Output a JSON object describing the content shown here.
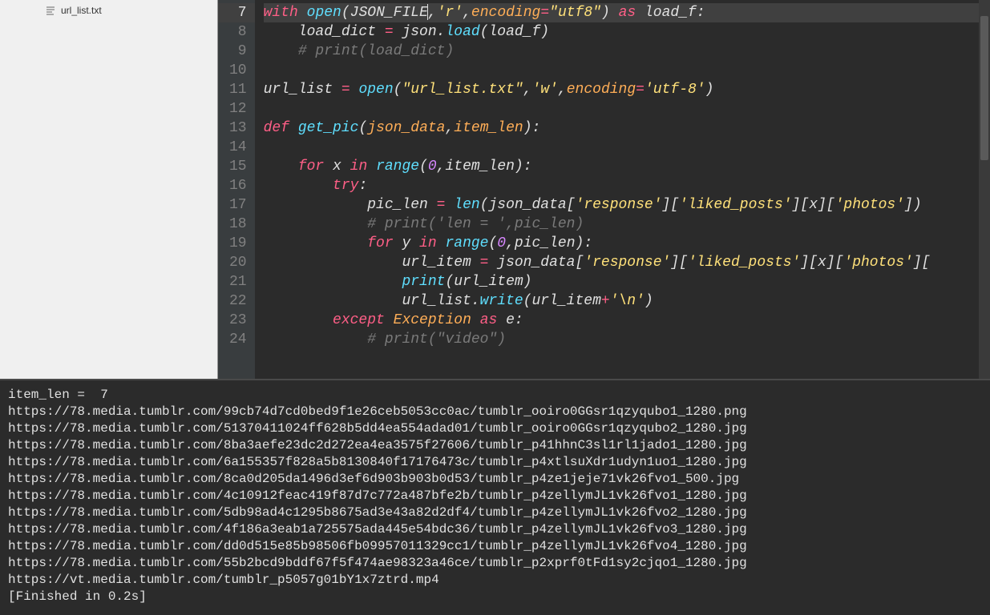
{
  "sidebar": {
    "files": [
      {
        "name": "url_list.txt",
        "icon": "text-lines-icon"
      }
    ]
  },
  "editor": {
    "active_line": 7,
    "lines": [
      {
        "n": 7,
        "tokens": [
          [
            "kw",
            "with"
          ],
          [
            "nm",
            " "
          ],
          [
            "fn",
            "open"
          ],
          [
            "nm",
            "(JSON_FILE"
          ],
          [
            "nm",
            ","
          ],
          [
            "str",
            "'r'"
          ],
          [
            "nm",
            ","
          ],
          [
            "param",
            "encoding"
          ],
          [
            "op",
            "="
          ],
          [
            "str",
            "\"utf8\""
          ],
          [
            "nm",
            ") "
          ],
          [
            "kw",
            "as"
          ],
          [
            "nm",
            " load_f:"
          ]
        ]
      },
      {
        "n": 8,
        "tokens": [
          [
            "nm",
            "    load_dict "
          ],
          [
            "op",
            "="
          ],
          [
            "nm",
            " json."
          ],
          [
            "fn",
            "load"
          ],
          [
            "nm",
            "(load_f)"
          ]
        ]
      },
      {
        "n": 9,
        "tokens": [
          [
            "nm",
            "    "
          ],
          [
            "cm",
            "# print(load_dict)"
          ]
        ]
      },
      {
        "n": 10,
        "tokens": []
      },
      {
        "n": 11,
        "tokens": [
          [
            "nm",
            "url_list "
          ],
          [
            "op",
            "="
          ],
          [
            "nm",
            " "
          ],
          [
            "fn",
            "open"
          ],
          [
            "nm",
            "("
          ],
          [
            "str",
            "\"url_list.txt\""
          ],
          [
            "nm",
            ","
          ],
          [
            "str",
            "'w'"
          ],
          [
            "nm",
            ","
          ],
          [
            "param",
            "encoding"
          ],
          [
            "op",
            "="
          ],
          [
            "str",
            "'utf-8'"
          ],
          [
            "nm",
            ")"
          ]
        ]
      },
      {
        "n": 12,
        "tokens": []
      },
      {
        "n": 13,
        "tokens": [
          [
            "kw",
            "def"
          ],
          [
            "nm",
            " "
          ],
          [
            "fn",
            "get_pic"
          ],
          [
            "nm",
            "("
          ],
          [
            "param",
            "json_data"
          ],
          [
            "nm",
            ","
          ],
          [
            "param",
            "item_len"
          ],
          [
            "nm",
            "):"
          ]
        ]
      },
      {
        "n": 14,
        "tokens": []
      },
      {
        "n": 15,
        "tokens": [
          [
            "nm",
            "    "
          ],
          [
            "kw",
            "for"
          ],
          [
            "nm",
            " x "
          ],
          [
            "kw",
            "in"
          ],
          [
            "nm",
            " "
          ],
          [
            "fn",
            "range"
          ],
          [
            "nm",
            "("
          ],
          [
            "num",
            "0"
          ],
          [
            "nm",
            ",item_len):"
          ]
        ]
      },
      {
        "n": 16,
        "tokens": [
          [
            "nm",
            "        "
          ],
          [
            "kw",
            "try"
          ],
          [
            "nm",
            ":"
          ]
        ]
      },
      {
        "n": 17,
        "tokens": [
          [
            "nm",
            "            pic_len "
          ],
          [
            "op",
            "="
          ],
          [
            "nm",
            " "
          ],
          [
            "fn",
            "len"
          ],
          [
            "nm",
            "(json_data["
          ],
          [
            "str",
            "'response'"
          ],
          [
            "nm",
            "]["
          ],
          [
            "str",
            "'liked_posts'"
          ],
          [
            "nm",
            "][x]["
          ],
          [
            "str",
            "'photos'"
          ],
          [
            "nm",
            "])"
          ]
        ]
      },
      {
        "n": 18,
        "tokens": [
          [
            "nm",
            "            "
          ],
          [
            "cm",
            "# print('len = ',pic_len)"
          ]
        ]
      },
      {
        "n": 19,
        "tokens": [
          [
            "nm",
            "            "
          ],
          [
            "kw",
            "for"
          ],
          [
            "nm",
            " y "
          ],
          [
            "kw",
            "in"
          ],
          [
            "nm",
            " "
          ],
          [
            "fn",
            "range"
          ],
          [
            "nm",
            "("
          ],
          [
            "num",
            "0"
          ],
          [
            "nm",
            ",pic_len):"
          ]
        ]
      },
      {
        "n": 20,
        "tokens": [
          [
            "nm",
            "                url_item "
          ],
          [
            "op",
            "="
          ],
          [
            "nm",
            " json_data["
          ],
          [
            "str",
            "'response'"
          ],
          [
            "nm",
            "]["
          ],
          [
            "str",
            "'liked_posts'"
          ],
          [
            "nm",
            "][x]["
          ],
          [
            "str",
            "'photos'"
          ],
          [
            "nm",
            "]["
          ]
        ]
      },
      {
        "n": 21,
        "tokens": [
          [
            "nm",
            "                "
          ],
          [
            "fn",
            "print"
          ],
          [
            "nm",
            "(url_item)"
          ]
        ]
      },
      {
        "n": 22,
        "tokens": [
          [
            "nm",
            "                url_list."
          ],
          [
            "fn",
            "write"
          ],
          [
            "nm",
            "(url_item"
          ],
          [
            "op",
            "+"
          ],
          [
            "str",
            "'\\n'"
          ],
          [
            "nm",
            ")"
          ]
        ]
      },
      {
        "n": 23,
        "tokens": [
          [
            "nm",
            "        "
          ],
          [
            "kw",
            "except"
          ],
          [
            "nm",
            " "
          ],
          [
            "param",
            "Exception"
          ],
          [
            "nm",
            " "
          ],
          [
            "kw",
            "as"
          ],
          [
            "nm",
            " e:"
          ]
        ]
      },
      {
        "n": 24,
        "tokens": [
          [
            "nm",
            "            "
          ],
          [
            "cm",
            "# print(\"video\")"
          ]
        ]
      }
    ]
  },
  "output": {
    "lines": [
      "item_len =  7",
      "https://78.media.tumblr.com/99cb74d7cd0bed9f1e26ceb5053cc0ac/tumblr_ooiro0GGsr1qzyqubo1_1280.png",
      "https://78.media.tumblr.com/51370411024ff628b5dd4ea554adad01/tumblr_ooiro0GGsr1qzyqubo2_1280.jpg",
      "https://78.media.tumblr.com/8ba3aefe23dc2d272ea4ea3575f27606/tumblr_p41hhnC3sl1rl1jado1_1280.jpg",
      "https://78.media.tumblr.com/6a155357f828a5b8130840f17176473c/tumblr_p4xtlsuXdr1udyn1uo1_1280.jpg",
      "https://78.media.tumblr.com/8ca0d205da1496d3ef6d903b903b0d53/tumblr_p4ze1jeje71vk26fvo1_500.jpg",
      "https://78.media.tumblr.com/4c10912feac419f87d7c772a487bfe2b/tumblr_p4zellymJL1vk26fvo1_1280.jpg",
      "https://78.media.tumblr.com/5db98ad4c1295b8675ad3e43a82d2df4/tumblr_p4zellymJL1vk26fvo2_1280.jpg",
      "https://78.media.tumblr.com/4f186a3eab1a725575ada445e54bdc36/tumblr_p4zellymJL1vk26fvo3_1280.jpg",
      "https://78.media.tumblr.com/dd0d515e85b98506fb09957011329cc1/tumblr_p4zellymJL1vk26fvo4_1280.jpg",
      "https://78.media.tumblr.com/55b2bcd9bddf67f5f474ae98323a46ce/tumblr_p2xprf0tFd1sy2cjqo1_1280.jpg",
      "https://vt.media.tumblr.com/tumblr_p5057g01bY1x7ztrd.mp4",
      "[Finished in 0.2s]"
    ]
  }
}
